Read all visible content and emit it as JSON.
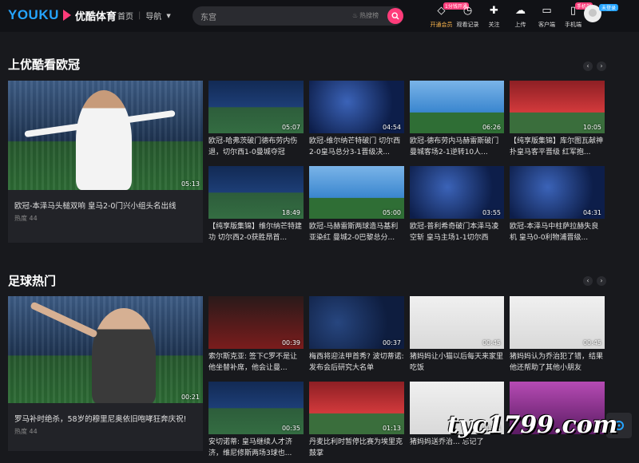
{
  "header": {
    "logo_en": "YOUKU",
    "logo_cn": "优酷体育",
    "nav_home": "首页",
    "nav_sep": "|",
    "nav_menu": "导航",
    "search_value": "东宫",
    "hot_label": "热搜榜",
    "icons": [
      {
        "name": "vip-icon",
        "label": "开通会员",
        "badge": "1分钱开通",
        "glyph": "◇"
      },
      {
        "name": "history-icon",
        "label": "观看记录",
        "badge": "",
        "glyph": "◷"
      },
      {
        "name": "follow-icon",
        "label": "关注",
        "badge": "",
        "glyph": "✚"
      },
      {
        "name": "upload-icon",
        "label": "上传",
        "badge": "",
        "glyph": "☁"
      },
      {
        "name": "client-icon",
        "label": "客户端",
        "badge": "",
        "glyph": "▭"
      },
      {
        "name": "phone-icon",
        "label": "手机端",
        "badge": "手机端",
        "glyph": "▯"
      }
    ],
    "login_tag": "未登录"
  },
  "sections": [
    {
      "title": "上优酷看欧冠",
      "big": {
        "title": "欧冠-本泽马头槌双响 皇马2-0门兴小组头名出线",
        "heat": "热度 44",
        "duration": "05:13"
      },
      "cards": [
        {
          "title": "欧冠-哈弗茨破门德布劳内伤退，切尔西1-0曼城夺冠",
          "duration": "05:07"
        },
        {
          "title": "欧冠-维尔纳芒特破门 切尔西2-0皇马总分3-1晋级决...",
          "duration": "04:54"
        },
        {
          "title": "欧冠-德布劳内马赫雷斯破门 曼城客场2-1逆转10人...",
          "duration": "06:26"
        },
        {
          "title": "【纯享版集锦】库尔图瓦献神扑皇马客平晋级 红军抱...",
          "duration": "10:05"
        },
        {
          "title": "【纯享版集锦】维尔纳芒特建功 切尔西2-0获胜昂首...",
          "duration": "18:49"
        },
        {
          "title": "欧冠-马赫雷斯两球造马基利亚染红 曼城2-0巴黎总分...",
          "duration": "05:00"
        },
        {
          "title": "欧冠-普利希奇破门本泽马凌空斩 皇马主场1-1切尔西",
          "duration": "03:55"
        },
        {
          "title": "欧冠-本泽马中柱萨拉赫失良机 皇马0-0利物浦晋级...",
          "duration": "04:31"
        }
      ]
    },
    {
      "title": "足球热门",
      "big": {
        "title": "罗马补时绝杀，58岁的穆里尼奥依旧咆哮狂奔庆祝!",
        "heat": "热度 44",
        "duration": "00:21"
      },
      "cards": [
        {
          "title": "索尔斯克亚: 签下C罗不是让他坐替补席，他会让曼...",
          "duration": "00:39"
        },
        {
          "title": "梅西将迎法甲首秀? 波切蒂诺: 发布会后研究大名单",
          "duration": "00:37"
        },
        {
          "title": "猪妈妈让小猫以后每天来家里吃饭",
          "duration": "00:45"
        },
        {
          "title": "猪妈妈认为乔治犯了错，结果他还帮助了其他小朋友",
          "duration": "00:45"
        },
        {
          "title": "安切诺蒂: 皇马继续人才济济，维尼修斯两场3球也...",
          "duration": "00:35"
        },
        {
          "title": "丹麦比利时暂停比赛为埃里克鼓掌",
          "duration": "01:13"
        },
        {
          "title": "猪妈妈送乔治... 忘记了",
          "duration": "00:44"
        },
        {
          "title": "",
          "duration": "00:32"
        }
      ]
    }
  ],
  "watermark": "tyc1799.com",
  "colors": {
    "accent": "#ff3c7a",
    "brand": "#25a4ff",
    "bg": "#18191d"
  }
}
